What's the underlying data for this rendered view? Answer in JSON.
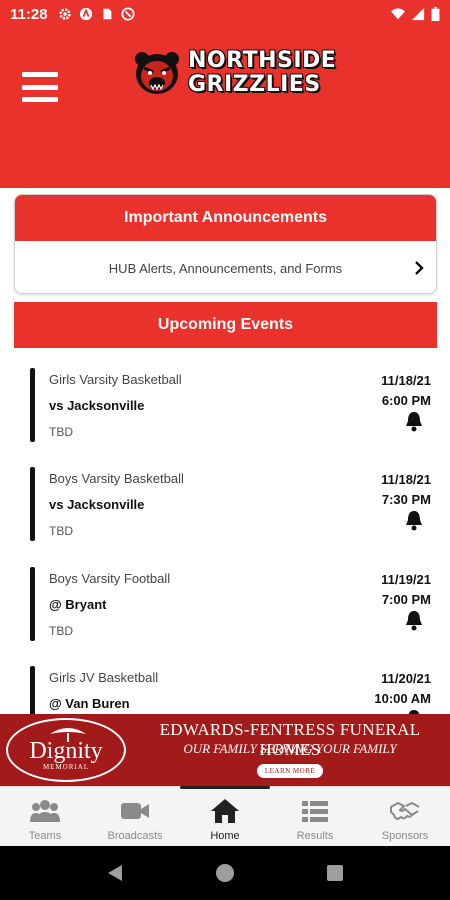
{
  "status_bar": {
    "time": "11:28",
    "icons_left": [
      "gear-icon",
      "app-icon",
      "sim-icon",
      "vpn-icon"
    ],
    "icons_right": [
      "wifi-icon",
      "signal-icon",
      "battery-icon"
    ]
  },
  "header": {
    "brand_line1": "NORTHSIDE",
    "brand_line2": "GRIZZLIES",
    "colors": {
      "primary": "#e8322b",
      "text": "#ffffff"
    }
  },
  "announcements": {
    "title": "Important Announcements",
    "row_label": "HUB Alerts, Announcements, and Forms"
  },
  "upcoming": {
    "title": "Upcoming Events",
    "events": [
      {
        "sport": "Girls Varsity Basketball",
        "opponent": "vs Jacksonville",
        "location": "TBD",
        "date": "11/18/21",
        "time": "6:00 PM"
      },
      {
        "sport": "Boys Varsity Basketball",
        "opponent": "vs Jacksonville",
        "location": "TBD",
        "date": "11/18/21",
        "time": "7:30 PM"
      },
      {
        "sport": "Boys Varsity Football",
        "opponent": "@ Bryant",
        "location": "TBD",
        "date": "11/19/21",
        "time": "7:00 PM"
      },
      {
        "sport": "Girls JV Basketball",
        "opponent": "@ Van Buren",
        "location": "",
        "date": "11/20/21",
        "time": "10:00 AM"
      }
    ]
  },
  "ad": {
    "logo_text": "Dignity",
    "logo_sub": "MEMORIAL",
    "title": "EDWARDS-FENTRESS FUNERAL HOMES",
    "tagline": "OUR FAMILY SERVING YOUR FAMILY",
    "button": "LEARN MORE",
    "background": "#a31a1a"
  },
  "tabs": [
    {
      "label": "Teams",
      "icon": "teams-icon",
      "active": false
    },
    {
      "label": "Broadcasts",
      "icon": "video-camera-icon",
      "active": false
    },
    {
      "label": "Home",
      "icon": "home-icon",
      "active": true
    },
    {
      "label": "Results",
      "icon": "results-list-icon",
      "active": false
    },
    {
      "label": "Sponsors",
      "icon": "handshake-icon",
      "active": false
    }
  ],
  "system_nav": [
    "back-icon",
    "home-circle-icon",
    "recents-icon"
  ]
}
